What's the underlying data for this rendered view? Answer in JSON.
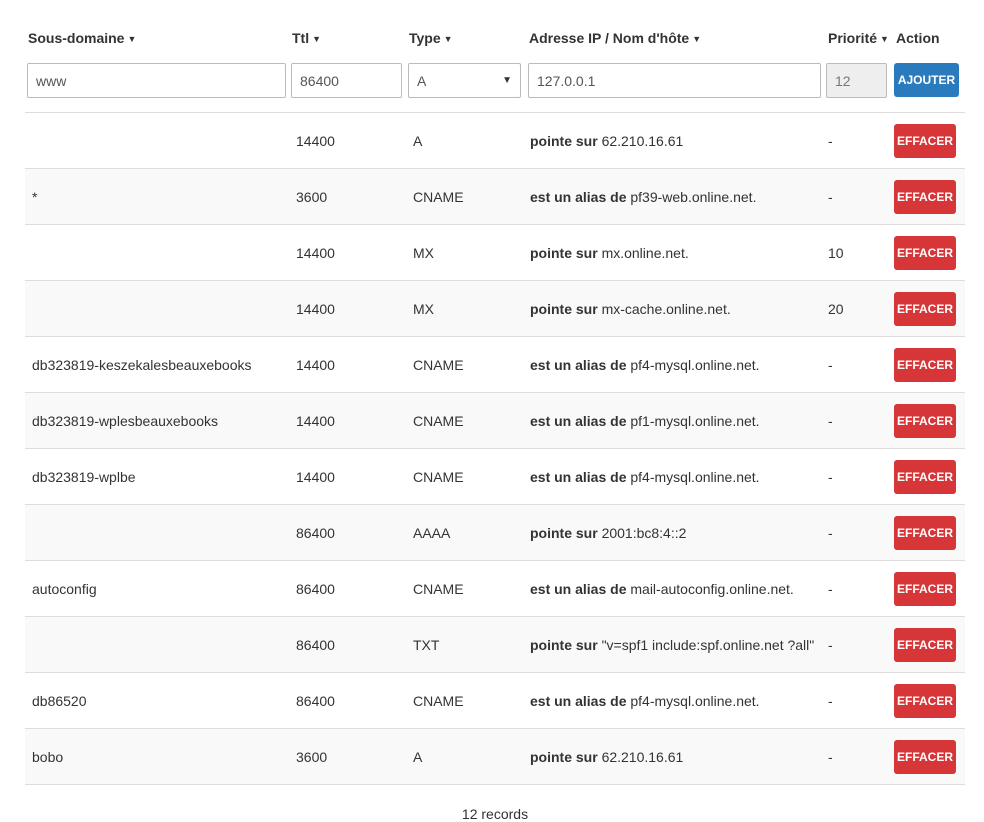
{
  "headers": {
    "subdomain": "Sous-domaine",
    "ttl": "Ttl",
    "type": "Type",
    "target": "Adresse IP / Nom d'hôte",
    "priority": "Priorité",
    "action": "Action"
  },
  "form": {
    "subdomain": "www",
    "ttl": "86400",
    "type": "A",
    "target": "127.0.0.1",
    "priority": "12",
    "add_label": "AJOUTER"
  },
  "records": [
    {
      "subdomain": "",
      "ttl": "14400",
      "type": "A",
      "label": "pointe sur",
      "target": "62.210.16.61",
      "priority": "-",
      "action": "EFFACER"
    },
    {
      "subdomain": "*",
      "ttl": "3600",
      "type": "CNAME",
      "label": "est un alias de",
      "target": "pf39-web.online.net.",
      "priority": "-",
      "action": "EFFACER"
    },
    {
      "subdomain": "",
      "ttl": "14400",
      "type": "MX",
      "label": "pointe sur",
      "target": "mx.online.net.",
      "priority": "10",
      "action": "EFFACER"
    },
    {
      "subdomain": "",
      "ttl": "14400",
      "type": "MX",
      "label": "pointe sur",
      "target": "mx-cache.online.net.",
      "priority": "20",
      "action": "EFFACER"
    },
    {
      "subdomain": "db323819-keszekalesbeauxebooks",
      "ttl": "14400",
      "type": "CNAME",
      "label": "est un alias de",
      "target": "pf4-mysql.online.net.",
      "priority": "-",
      "action": "EFFACER"
    },
    {
      "subdomain": "db323819-wplesbeauxebooks",
      "ttl": "14400",
      "type": "CNAME",
      "label": "est un alias de",
      "target": "pf1-mysql.online.net.",
      "priority": "-",
      "action": "EFFACER"
    },
    {
      "subdomain": "db323819-wplbe",
      "ttl": "14400",
      "type": "CNAME",
      "label": "est un alias de",
      "target": "pf4-mysql.online.net.",
      "priority": "-",
      "action": "EFFACER"
    },
    {
      "subdomain": "",
      "ttl": "86400",
      "type": "AAAA",
      "label": "pointe sur",
      "target": "2001:bc8:4::2",
      "priority": "-",
      "action": "EFFACER"
    },
    {
      "subdomain": "autoconfig",
      "ttl": "86400",
      "type": "CNAME",
      "label": "est un alias de",
      "target": "mail-autoconfig.online.net.",
      "priority": "-",
      "action": "EFFACER"
    },
    {
      "subdomain": "",
      "ttl": "86400",
      "type": "TXT",
      "label": "pointe sur",
      "target": "\"v=spf1 include:spf.online.net ?all\"",
      "priority": "-",
      "action": "EFFACER"
    },
    {
      "subdomain": "db86520",
      "ttl": "86400",
      "type": "CNAME",
      "label": "est un alias de",
      "target": "pf4-mysql.online.net.",
      "priority": "-",
      "action": "EFFACER"
    },
    {
      "subdomain": "bobo",
      "ttl": "3600",
      "type": "A",
      "label": "pointe sur",
      "target": "62.210.16.61",
      "priority": "-",
      "action": "EFFACER"
    }
  ],
  "footer": {
    "count": "12 records"
  },
  "colors": {
    "add_button": "#2a7bbd",
    "delete_button": "#d63638",
    "stripe": "#f9f9f9"
  },
  "icons": {
    "sort": "caret-down-icon",
    "select": "select-arrow-icon"
  }
}
